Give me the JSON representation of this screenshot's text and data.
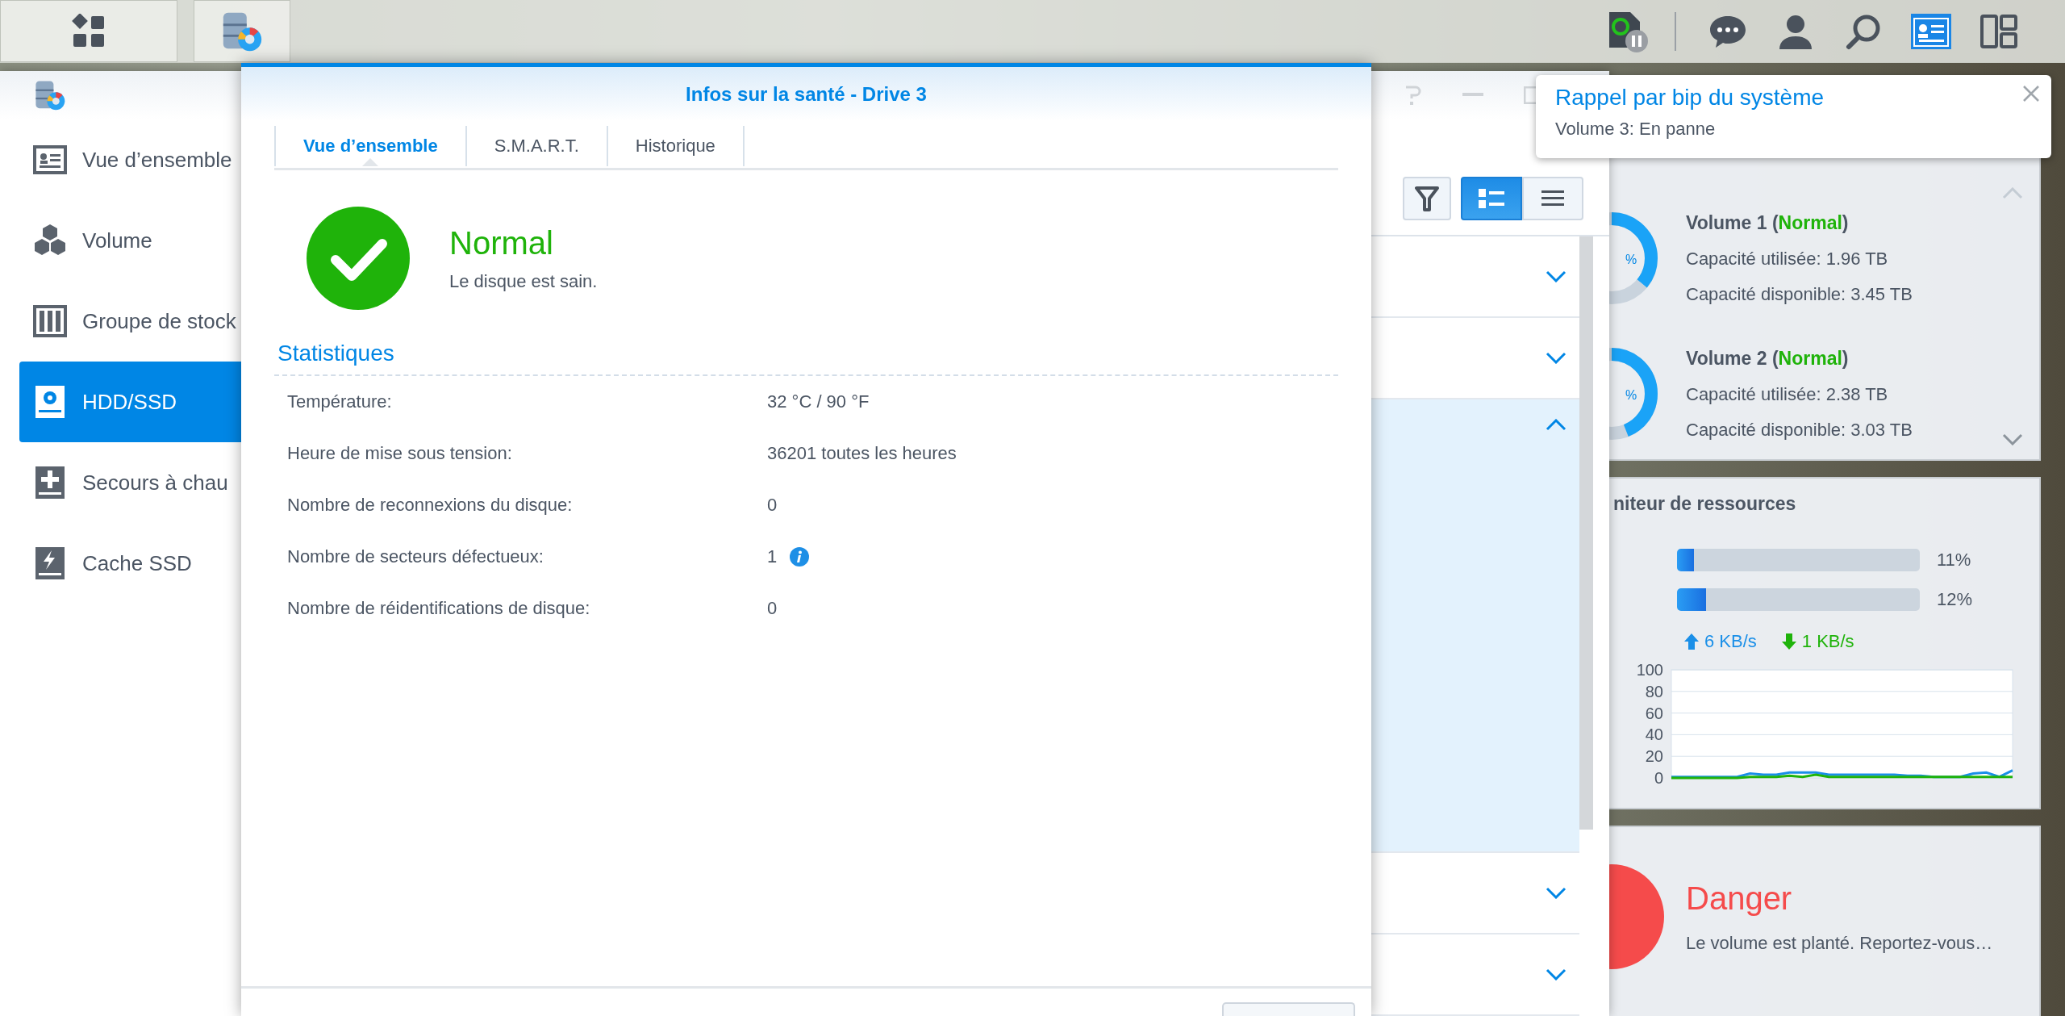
{
  "taskbar": {
    "left_buttons": [
      {
        "kind": "main-menu"
      },
      {
        "kind": "storage-app"
      }
    ],
    "right_icons": [
      {
        "kind": "status",
        "selected": false
      },
      {
        "kind": "chat",
        "selected": false
      },
      {
        "kind": "user",
        "selected": false
      },
      {
        "kind": "search",
        "selected": false
      },
      {
        "kind": "widgets",
        "selected": true
      },
      {
        "kind": "layout",
        "selected": false
      }
    ]
  },
  "storage_manager": {
    "sidebar": [
      {
        "label": "Vue d’ensemble",
        "kind": "overview",
        "selected": false
      },
      {
        "label": "Volume",
        "kind": "volume",
        "selected": false
      },
      {
        "label": "Groupe de stock",
        "kind": "pool",
        "selected": false
      },
      {
        "label": "HDD/SSD",
        "kind": "hdd",
        "selected": true
      },
      {
        "label": "Secours à chau",
        "kind": "hotspare",
        "selected": false
      },
      {
        "label": "Cache SSD",
        "kind": "cache",
        "selected": false
      }
    ],
    "view_toggle": [
      {
        "kind": "cards",
        "selected": true
      },
      {
        "kind": "list",
        "selected": false
      }
    ],
    "list_rows": [
      {
        "expanded": false
      },
      {
        "expanded": false
      },
      {
        "expanded": true
      },
      {
        "expanded": false
      },
      {
        "expanded": false
      }
    ]
  },
  "dialog": {
    "title": "Infos sur la santé - Drive 3",
    "tabs": [
      {
        "label": "Vue d’ensemble",
        "selected": true
      },
      {
        "label": "S.M.A.R.T.",
        "selected": false
      },
      {
        "label": "Historique",
        "selected": false
      }
    ],
    "status": {
      "kind": "ok",
      "label": "Normal",
      "message": "Le disque est sain."
    },
    "section_title": "Statistiques",
    "stats": [
      {
        "label": "Température:",
        "value": "32 °C / 90 °F",
        "info": false
      },
      {
        "label": "Heure de mise sous tension:",
        "value": "36201 toutes les heures",
        "info": false
      },
      {
        "label": "Nombre de reconnexions du disque:",
        "value": "0",
        "info": false
      },
      {
        "label": "Nombre de secteurs défectueux:",
        "value": "1",
        "info": true
      },
      {
        "label": "Nombre de réidentifications de disque:",
        "value": "0",
        "info": false
      }
    ]
  },
  "notification": {
    "title": "Rappel par bip du système",
    "message": "Volume 3: En panne"
  },
  "widgets": {
    "storage": {
      "volumes": [
        {
          "label_before": "Volume 1 (",
          "status": "Normal",
          "label_after": ")",
          "usage_label": "%",
          "level": 0.36,
          "used": "Capacité utilisée: 1.96 TB",
          "available": "Capacité disponible: 3.45 TB"
        },
        {
          "label_before": "Volume 2 (",
          "status": "Normal",
          "label_after": ")",
          "usage_label": "%",
          "level": 0.44,
          "used": "Capacité utilisée: 2.38 TB",
          "available": "Capacité disponible: 3.03 TB"
        }
      ]
    },
    "resource_monitor": {
      "title": "niteur de ressources",
      "meters": [
        {
          "level": 0.07,
          "reading": "11%"
        },
        {
          "level": 0.12,
          "reading": "12%"
        }
      ],
      "upload": "6 KB/s",
      "download": "1 KB/s",
      "chart_data": {
        "type": "line",
        "grid": true,
        "ylim": [
          0,
          100
        ],
        "yticks": [
          0,
          20,
          40,
          60,
          80,
          100
        ],
        "series": [
          {
            "color": "#1a8fe8",
            "values": [
              1,
              1,
              1,
              1,
              1,
              1,
              4,
              3,
              3,
              5,
              5,
              5,
              3,
              3,
              3,
              3,
              3,
              3,
              2,
              2,
              1,
              1,
              1,
              4,
              5,
              1,
              7
            ]
          },
          {
            "color": "#1fb30a",
            "values": [
              0,
              0,
              0,
              0,
              0,
              0,
              1,
              1,
              1,
              2,
              1,
              3,
              1,
              1,
              1,
              1,
              1,
              1,
              1,
              1,
              1,
              1,
              1,
              1,
              1,
              1,
              1
            ]
          }
        ]
      }
    },
    "system_health": {
      "kind": "danger",
      "status": "Danger",
      "message": "Le volume est planté. Reportez-vous…"
    }
  }
}
